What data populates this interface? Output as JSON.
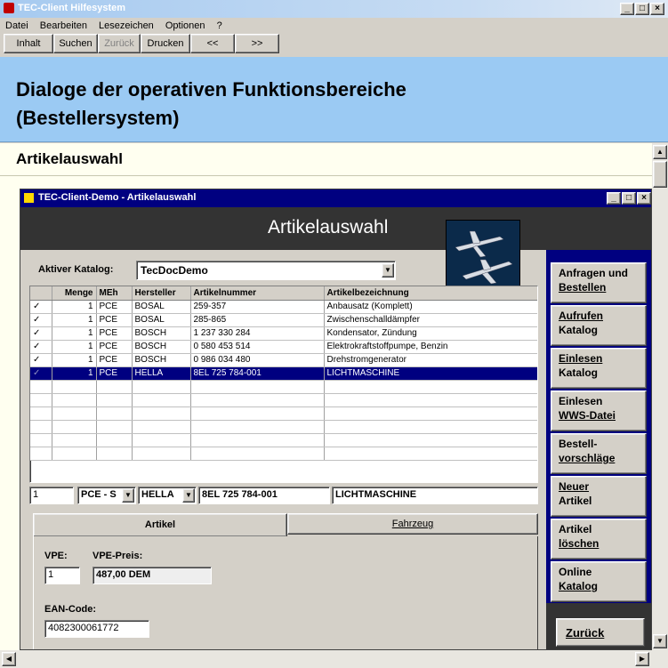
{
  "window": {
    "title": "TEC-Client Hilfesystem"
  },
  "menu": [
    "Datei",
    "Bearbeiten",
    "Lesezeichen",
    "Optionen",
    "?"
  ],
  "toolbar": {
    "inhalt": "Inhalt",
    "suchen": "Suchen",
    "zurueck": "Zurück",
    "drucken": "Drucken",
    "prev": "<<",
    "next": ">>"
  },
  "help": {
    "heading_line1": "Dialoge der operativen Funktionsbereiche",
    "heading_line2": "(Bestellersystem)",
    "section": "Artikelauswahl"
  },
  "inner": {
    "title": "TEC-Client-Demo - Artikelauswahl",
    "banner": "Artikelauswahl",
    "catalog_label": "Aktiver Katalog:",
    "catalog_value": "TecDocDemo",
    "columns": [
      "Menge",
      "MEh",
      "Hersteller",
      "Artikelnummer",
      "Artikelbezeichnung"
    ],
    "rows": [
      {
        "qty": "1",
        "unit": "PCE",
        "maker": "BOSAL",
        "number": "259-357",
        "desc": "Anbausatz (Komplett)"
      },
      {
        "qty": "1",
        "unit": "PCE",
        "maker": "BOSAL",
        "number": "285-865",
        "desc": "Zwischenschalldämpfer"
      },
      {
        "qty": "1",
        "unit": "PCE",
        "maker": "BOSCH",
        "number": "1 237 330 284",
        "desc": "Kondensator, Zündung"
      },
      {
        "qty": "1",
        "unit": "PCE",
        "maker": "BOSCH",
        "number": "0 580 453 514",
        "desc": "Elektrokraftstoffpumpe, Benzin"
      },
      {
        "qty": "1",
        "unit": "PCE",
        "maker": "BOSCH",
        "number": "0 986 034 480",
        "desc": "Drehstromgenerator"
      },
      {
        "qty": "1",
        "unit": "PCE",
        "maker": "HELLA",
        "number": "8EL 725 784-001",
        "desc": "LICHTMASCHINE"
      }
    ],
    "edit": {
      "qty": "1",
      "unit": "PCE - S",
      "maker": "HELLA",
      "number": "8EL 725 784-001",
      "desc": "LICHTMASCHINE"
    },
    "tabs": {
      "artikel": "Artikel",
      "fahrzeug": "Fahrzeug"
    },
    "vpe_label": "VPE:",
    "vpe_value": "1",
    "vpe_preis_label": "VPE-Preis:",
    "vpe_preis_value": "487,00 DEM",
    "ean_label": "EAN-Code:",
    "ean_value": "4082300061772",
    "side": [
      {
        "l1": "Anfragen und",
        "l2": "Bestellen"
      },
      {
        "l1": "Aufrufen",
        "l2": "Katalog"
      },
      {
        "l1": "Einlesen",
        "l2": "Katalog"
      },
      {
        "l1": "Einlesen",
        "l2": "WWS-Datei"
      },
      {
        "l1": "Bestell-",
        "l2": "vorschläge"
      },
      {
        "l1": "Neuer",
        "l2": "Artikel"
      },
      {
        "l1": "Artikel",
        "l2": "löschen"
      },
      {
        "l1": "Online",
        "l2": "Katalog"
      }
    ],
    "zurueck_btn": "Zurück"
  },
  "colors": {
    "heading_bg": "#9bcaf3",
    "inner_title": "#000080",
    "banner_bg": "#333333",
    "selection": "#000080"
  }
}
